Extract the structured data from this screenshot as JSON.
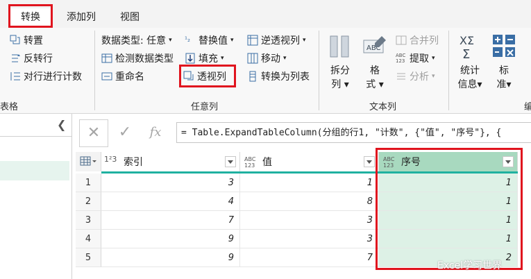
{
  "tabs": [
    {
      "label": "转换",
      "active": true
    },
    {
      "label": "添加列",
      "active": false
    },
    {
      "label": "视图",
      "active": false
    }
  ],
  "ribbon": {
    "table_group": {
      "label": "表格",
      "items": [
        "转置",
        "反转行",
        "对行进行计数"
      ]
    },
    "any_column_group": {
      "label": "任意列",
      "data_type": "数据类型: 任意",
      "detect_type": "检测数据类型",
      "rename": "重命名",
      "replace_values": "替换值",
      "fill": "填充",
      "pivot_column": "透视列",
      "unpivot_columns": "逆透视列",
      "move": "移动",
      "convert_to_list": "转换为列表"
    },
    "text_group": {
      "label": "文本列",
      "split_column": [
        "拆分",
        "列"
      ],
      "format": [
        "格",
        "式"
      ],
      "merge_columns": "合并列",
      "extract": "提取",
      "parse": "分析"
    },
    "number_group": {
      "statistics": [
        "统计",
        "信息"
      ],
      "standard": [
        "标",
        "准"
      ],
      "cut_label": "编"
    }
  },
  "formula_bar": {
    "cancel": "✕",
    "confirm": "✓",
    "fx": "fx",
    "formula": "= Table.ExpandTableColumn(分组的行1, \"计数\", {\"值\", \"序号\"}, {"
  },
  "table": {
    "columns": [
      {
        "name": "索引",
        "type_icon": "1²3"
      },
      {
        "name": "值",
        "type_icon": "ABC 123"
      },
      {
        "name": "序号",
        "type_icon": "ABC 123"
      }
    ],
    "rows": [
      {
        "num": "1",
        "index": "3",
        "value": "1",
        "seq": "1"
      },
      {
        "num": "2",
        "index": "4",
        "value": "8",
        "seq": "1"
      },
      {
        "num": "3",
        "index": "7",
        "value": "3",
        "seq": "1"
      },
      {
        "num": "4",
        "index": "9",
        "value": "3",
        "seq": "1"
      },
      {
        "num": "5",
        "index": "9",
        "value": "7",
        "seq": "2"
      }
    ]
  },
  "watermark": "Excel学习世界",
  "colors": {
    "accent_red": "#e0141e",
    "column_bar": "#1fb1a0",
    "selected_column": "#ddf1e6"
  }
}
